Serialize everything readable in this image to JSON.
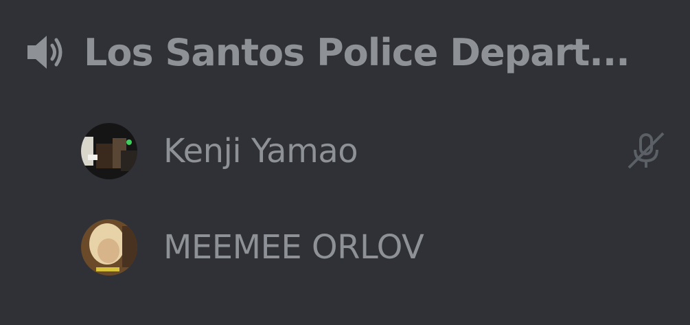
{
  "channel": {
    "name": "Los Santos Police Depart...",
    "icon": "speaker-icon"
  },
  "members": [
    {
      "name": "Kenji Yamao",
      "avatar": "avatar",
      "status_icon": "mic-muted-icon"
    },
    {
      "name": "MEEMEE ORLOV",
      "avatar": "avatar"
    }
  ],
  "colors": {
    "background": "#2f3136",
    "text": "#8e9297",
    "icon": "#72767d"
  }
}
